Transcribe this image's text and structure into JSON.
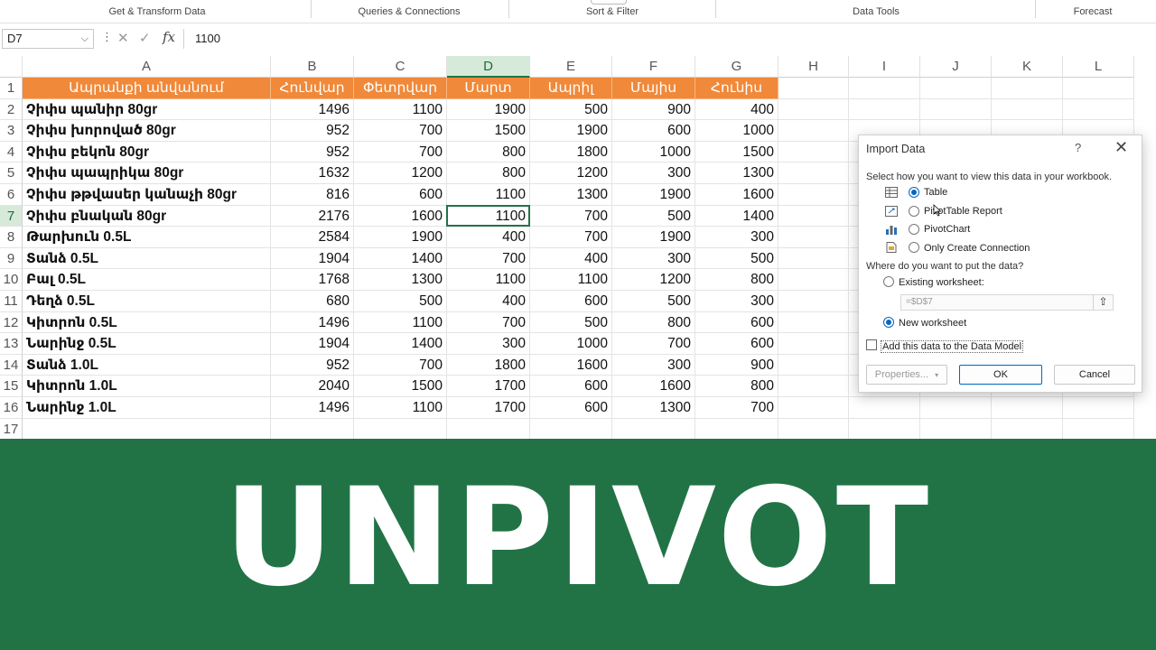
{
  "ribbon": {
    "groups": [
      "Get & Transform Data",
      "Queries & Connections",
      "Sort & Filter",
      "Data Tools",
      "Forecast"
    ]
  },
  "formula_bar": {
    "name_box": "D7",
    "fx_label": "fx",
    "value": "1100"
  },
  "columns": [
    "A",
    "B",
    "C",
    "D",
    "E",
    "F",
    "G",
    "H",
    "I",
    "J",
    "K",
    "L"
  ],
  "rows": [
    "1",
    "2",
    "3",
    "4",
    "5",
    "6",
    "7",
    "8",
    "9",
    "10",
    "11",
    "12",
    "13",
    "14",
    "15",
    "16",
    "17"
  ],
  "table": {
    "headers": [
      "Ապրանքի անվանում",
      "Հունվար",
      "Փետրվար",
      "Մարտ",
      "Ապրիլ",
      "Մայիս",
      "Հունիս"
    ],
    "rows": [
      [
        "Չիփս  պանիր 80gr",
        "1496",
        "1100",
        "1900",
        "500",
        "900",
        "400"
      ],
      [
        "Չիփս  խորոված 80gr",
        "952",
        "700",
        "1500",
        "1900",
        "600",
        "1000"
      ],
      [
        "Չիփս բեկոն 80gr",
        "952",
        "700",
        "800",
        "1800",
        "1000",
        "1500"
      ],
      [
        "Չիփս  պապրիկա 80gr",
        "1632",
        "1200",
        "800",
        "1200",
        "300",
        "1300"
      ],
      [
        "Չիփս  թթվասեր  կանաչի 80gr",
        "816",
        "600",
        "1100",
        "1300",
        "1900",
        "1600"
      ],
      [
        "Չիփս բնական 80gr",
        "2176",
        "1600",
        "1100",
        "700",
        "500",
        "1400"
      ],
      [
        "Թարխուն 0.5L",
        "2584",
        "1900",
        "400",
        "700",
        "1900",
        "300"
      ],
      [
        "Տանձ 0.5L",
        "1904",
        "1400",
        "700",
        "400",
        "300",
        "500"
      ],
      [
        "Բալ 0.5L",
        "1768",
        "1300",
        "1100",
        "1100",
        "1200",
        "800"
      ],
      [
        "Դեղձ 0.5L",
        "680",
        "500",
        "400",
        "600",
        "500",
        "300"
      ],
      [
        "Կիտրոն 0.5L",
        "1496",
        "1100",
        "700",
        "500",
        "800",
        "600"
      ],
      [
        "Նարինջ 0.5L",
        "1904",
        "1400",
        "300",
        "1000",
        "700",
        "600"
      ],
      [
        "Տանձ 1.0L",
        "952",
        "700",
        "1800",
        "1600",
        "300",
        "900"
      ],
      [
        "Կիտրոն 1.0L",
        "2040",
        "1500",
        "1700",
        "600",
        "1600",
        "800"
      ],
      [
        "Նարինջ 1.0L",
        "1496",
        "1100",
        "1700",
        "600",
        "1300",
        "700"
      ]
    ]
  },
  "dialog": {
    "title": "Import Data",
    "help": "?",
    "close": "✕",
    "view_prompt": "Select how you want to view this data in your workbook.",
    "view_options": [
      "Table",
      "PivotTable Report",
      "PivotChart",
      "Only Create Connection"
    ],
    "selected_view": "Table",
    "where_prompt": "Where do you want to put the data?",
    "existing_label": "Existing worksheet:",
    "existing_ref": "=$D$7",
    "new_label": "New worksheet",
    "selected_where": "New worksheet",
    "data_model_label": "Add this data to the Data Model",
    "data_model_checked": false,
    "properties_label": "Properties...",
    "ok_label": "OK",
    "cancel_label": "Cancel"
  },
  "banner": {
    "text": "UNPIVOT",
    "color": "#217346"
  },
  "colors": {
    "header_fill": "#f0893a",
    "excel_green": "#217346"
  }
}
